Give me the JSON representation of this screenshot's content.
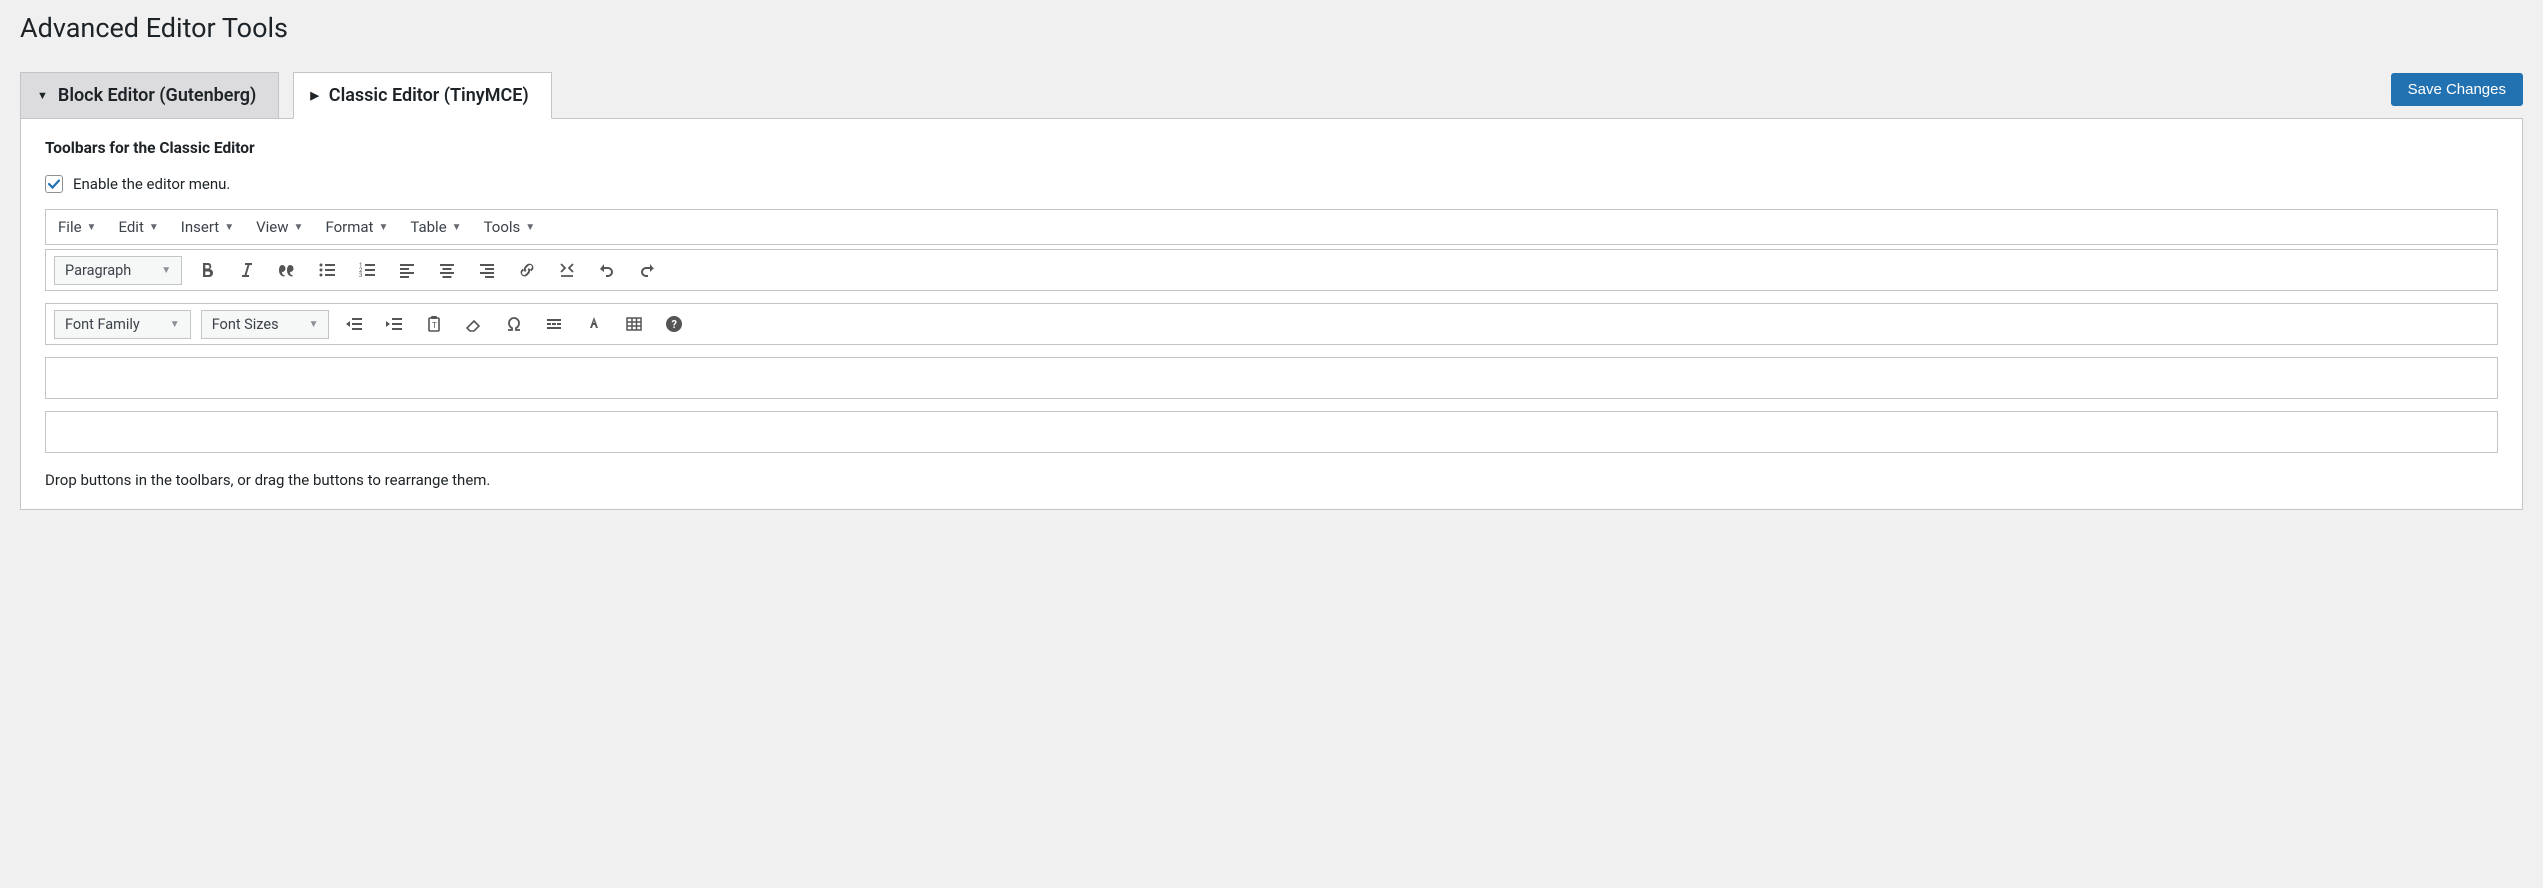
{
  "page": {
    "title": "Advanced Editor Tools"
  },
  "tabs": {
    "block": {
      "label": "Block Editor (Gutenberg)"
    },
    "classic": {
      "label": "Classic Editor (TinyMCE)"
    }
  },
  "save_button": {
    "label": "Save Changes"
  },
  "section": {
    "title": "Toolbars for the Classic Editor",
    "enable_menu_label": "Enable the editor menu.",
    "enable_menu_checked": true,
    "help_text": "Drop buttons in the toolbars, or drag the buttons to rearrange them."
  },
  "menubar": [
    {
      "label": "File"
    },
    {
      "label": "Edit"
    },
    {
      "label": "Insert"
    },
    {
      "label": "View"
    },
    {
      "label": "Format"
    },
    {
      "label": "Table"
    },
    {
      "label": "Tools"
    }
  ],
  "toolbar1": {
    "format_dd": "Paragraph"
  },
  "toolbar2": {
    "font_family_dd": "Font Family",
    "font_sizes_dd": "Font Sizes"
  }
}
